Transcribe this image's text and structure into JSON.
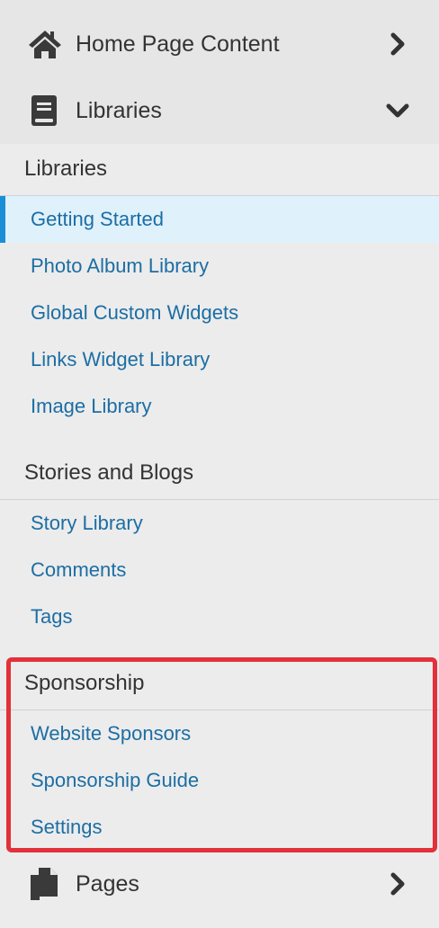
{
  "nav": {
    "home_page_content": {
      "label": "Home Page Content",
      "icon": "home-icon",
      "chevron": "chevron-right-icon"
    },
    "libraries": {
      "label": "Libraries",
      "icon": "book-icon",
      "chevron": "chevron-down-icon"
    },
    "pages": {
      "label": "Pages",
      "icon": "copy-icon",
      "chevron": "chevron-right-icon"
    }
  },
  "sections": [
    {
      "title": "Libraries",
      "items": [
        {
          "label": "Getting Started",
          "active": true
        },
        {
          "label": "Photo Album Library"
        },
        {
          "label": "Global Custom Widgets"
        },
        {
          "label": "Links Widget Library"
        },
        {
          "label": "Image Library"
        }
      ]
    },
    {
      "title": "Stories and Blogs",
      "items": [
        {
          "label": "Story Library"
        },
        {
          "label": "Comments"
        },
        {
          "label": "Tags"
        }
      ]
    },
    {
      "title": "Sponsorship",
      "items": [
        {
          "label": "Website Sponsors"
        },
        {
          "label": "Sponsorship Guide"
        },
        {
          "label": "Settings"
        }
      ]
    }
  ],
  "colors": {
    "link": "#1c6ea4",
    "active_bar": "#1a8fd6",
    "active_bg": "#dff1fb",
    "highlight_border": "#e2313a",
    "nav_icon": "#3a3a3a"
  }
}
